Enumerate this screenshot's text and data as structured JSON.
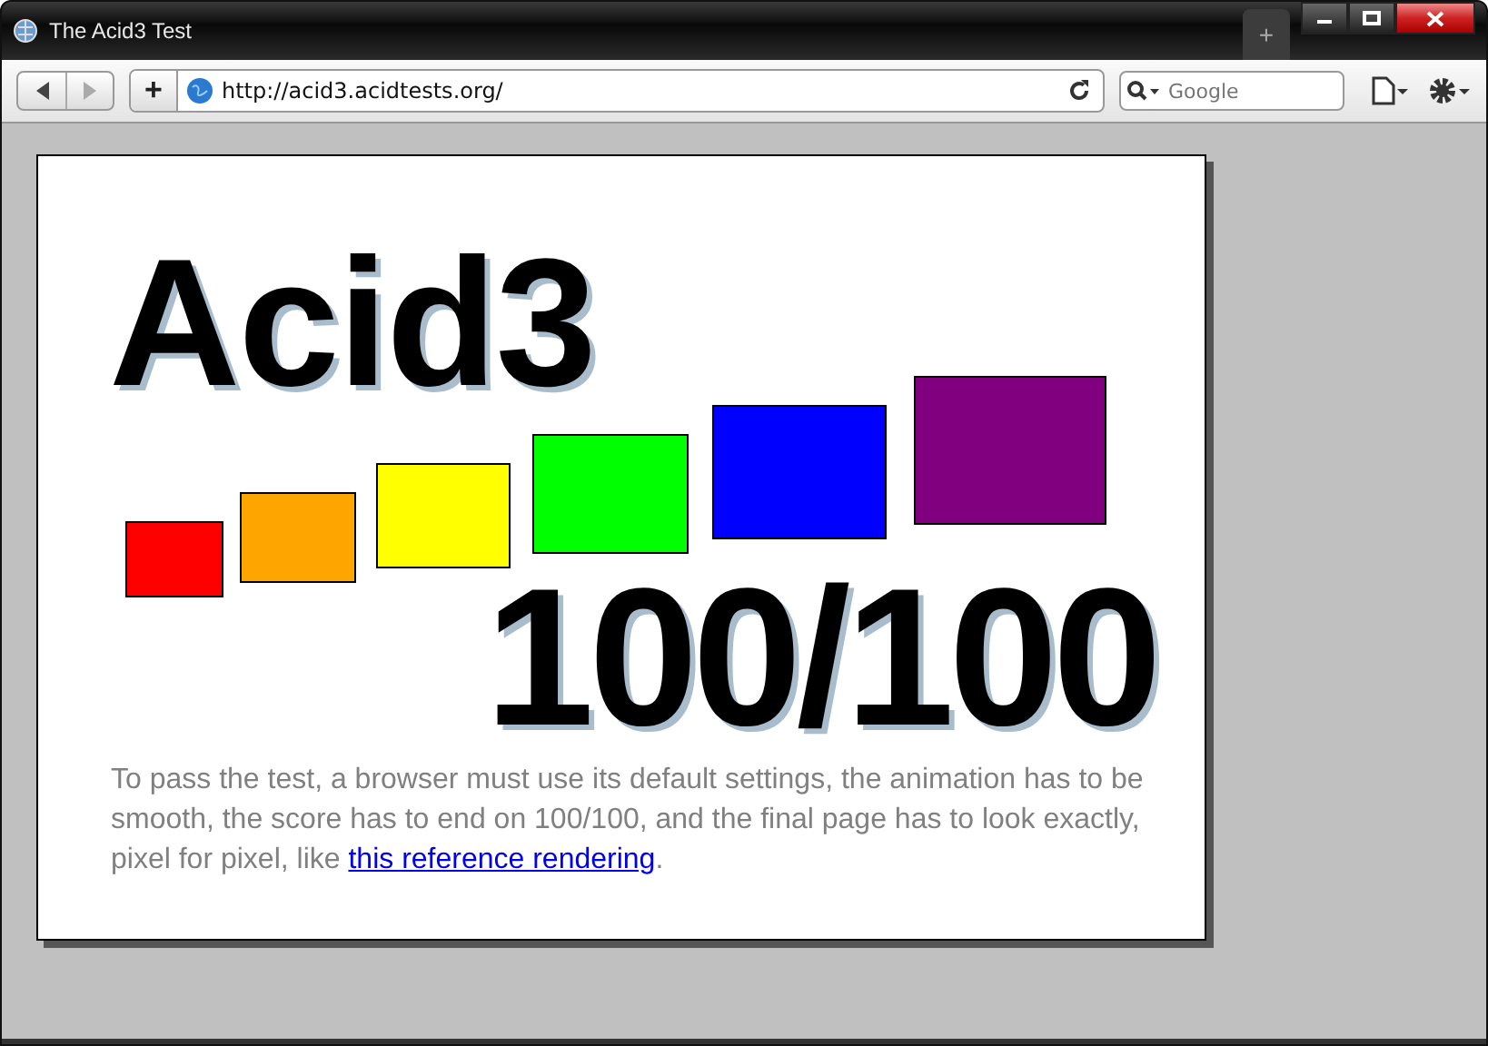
{
  "window": {
    "title": "The Acid3 Test"
  },
  "toolbar": {
    "new_tab": "+",
    "url": "http://acid3.acidtests.org/",
    "search": {
      "placeholder": "Google"
    }
  },
  "page": {
    "heading": "Acid3",
    "score": "100/100",
    "squares": [
      {
        "color": "#ff0000"
      },
      {
        "color": "#ffa500"
      },
      {
        "color": "#ffff00"
      },
      {
        "color": "#00ff00"
      },
      {
        "color": "#0000ff"
      },
      {
        "color": "#800080"
      }
    ],
    "text": "To pass the test, a browser must use its default settings, the animation has to be smooth, the score has to end on 100/100, and the final page has to look exactly, pixel for pixel, like ",
    "link": "this reference rendering",
    "text_end": "."
  }
}
